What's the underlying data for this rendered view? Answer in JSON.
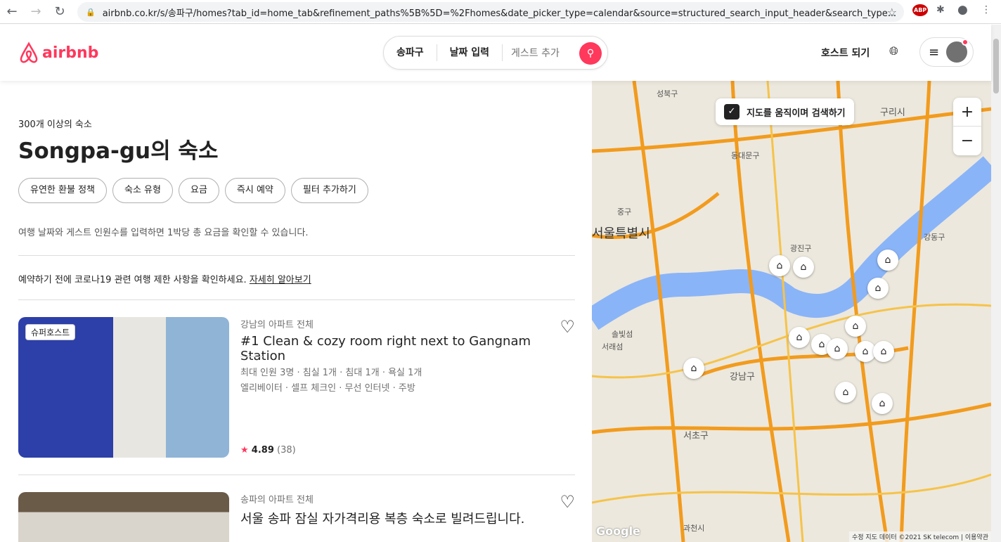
{
  "browser": {
    "url": "airbnb.co.kr/s/송파구/homes?tab_id=home_tab&refinement_paths%5B%5D=%2Fhomes&date_picker_type=calendar&source=structured_search_input_header&search_type...",
    "abp": "ABP"
  },
  "header": {
    "logo": "airbnb",
    "search": {
      "location": "송파구",
      "dates": "날짜 입력",
      "guests": "게스트 추가"
    },
    "host": "호스트 되기"
  },
  "main": {
    "count": "300개 이상의 숙소",
    "title": "Songpa-gu의 숙소",
    "filters": [
      "유연한 환불 정책",
      "숙소 유형",
      "요금",
      "즉시 예약",
      "필터 추가하기"
    ],
    "note": "여행 날짜와 게스트 인원수를 입력하면 1박당 총 요금을 확인할 수 있습니다.",
    "covid": "예약하기 전에 코로나19 관련 여행 제한 사항을 확인하세요.",
    "covid_link": "자세히 알아보기",
    "listings": [
      {
        "badge": "슈퍼호스트",
        "type": "강남의 아파트 전체",
        "title": "#1 Clean & cozy room right next to Gangnam Station",
        "details": "최대 인원 3명 · 침실 1개 · 침대 1개 · 욕실 1개",
        "amenities": "엘리베이터 · 셀프 체크인 · 무선 인터넷 · 주방",
        "rating": "4.89",
        "reviews": "(38)"
      },
      {
        "type": "송파의 아파트 전체",
        "title": "서울 송파 잠실 자가격리용 복층 숙소로 빌려드립니다."
      }
    ]
  },
  "map": {
    "toggle": "지도를 움직이며 검색하기",
    "labels": [
      "성북구",
      "동대문구",
      "구리시",
      "중구",
      "서울특별시",
      "광진구",
      "강동구",
      "솔빛섬",
      "서래섬",
      "강남구",
      "서초구",
      "과천시"
    ],
    "attribution": "수정 지도 데이터 ©2021 SK telecom",
    "terms": "이용약관",
    "google": "Google"
  }
}
